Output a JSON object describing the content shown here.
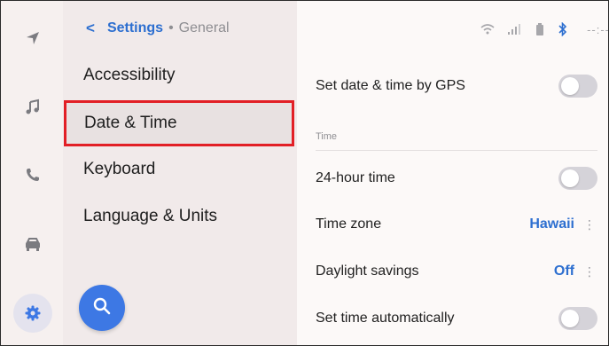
{
  "breadcrumb": {
    "back": "<",
    "parent": "Settings",
    "separator": "•",
    "current": "General"
  },
  "menu": {
    "items": [
      {
        "label": "Accessibility"
      },
      {
        "label": "Date & Time",
        "selected": true
      },
      {
        "label": "Keyboard"
      },
      {
        "label": "Language & Units"
      }
    ]
  },
  "rail": {
    "icons": [
      "navigation-icon",
      "music-icon",
      "phone-icon",
      "car-icon",
      "gear-icon"
    ],
    "active": "gear-icon"
  },
  "status": {
    "icons": [
      "wifi-icon",
      "signal-icon",
      "battery-icon",
      "bluetooth-icon"
    ],
    "clock": "--:--"
  },
  "content": {
    "gps_row": {
      "label": "Set date & time by GPS",
      "toggle_on": false
    },
    "section_title": "Time",
    "hour24_row": {
      "label": "24-hour time",
      "toggle_on": false
    },
    "timezone_row": {
      "label": "Time zone",
      "value": "Hawaii",
      "more": "⋮"
    },
    "dst_row": {
      "label": "Daylight savings",
      "value": "Off",
      "more": "⋮"
    },
    "auto_row": {
      "label": "Set time automatically",
      "toggle_on": false
    }
  },
  "colors": {
    "accent": "#2d6fd0",
    "fab": "#3d78e4",
    "highlight_border": "#e21f26",
    "toggle_off": "#d5d3d9"
  }
}
